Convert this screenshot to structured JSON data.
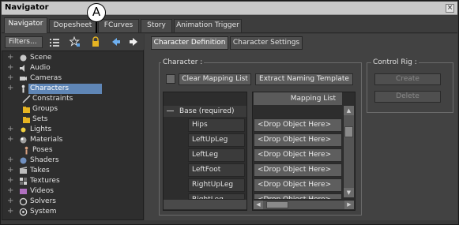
{
  "window": {
    "title": "Navigator",
    "close_glyph": "×"
  },
  "annotation": {
    "letter": "A"
  },
  "main_tabs": [
    {
      "label": "Navigator",
      "active": true
    },
    {
      "label": "Dopesheet",
      "active": false
    },
    {
      "label": "FCurves",
      "active": false
    },
    {
      "label": "Story",
      "active": false
    },
    {
      "label": "Animation Trigger",
      "active": false
    }
  ],
  "toolbar": {
    "filters_label": "Filters...",
    "icons": [
      "list-view-icon",
      "star-filter-icon",
      "lock-icon",
      "arrow-left-icon",
      "arrow-right-icon"
    ]
  },
  "tree": {
    "items": [
      {
        "label": "Scene",
        "icon": "scene-icon",
        "expander": "+"
      },
      {
        "label": "Audio",
        "icon": "audio-icon",
        "expander": "+"
      },
      {
        "label": "Cameras",
        "icon": "camera-icon",
        "expander": "+"
      },
      {
        "label": "Characters",
        "icon": "character-icon",
        "expander": "+",
        "selected": true
      },
      {
        "label": "Constraints",
        "icon": "constraint-icon",
        "expander": ""
      },
      {
        "label": "Groups",
        "icon": "group-icon",
        "expander": ""
      },
      {
        "label": "Sets",
        "icon": "set-icon",
        "expander": ""
      },
      {
        "label": "Lights",
        "icon": "light-icon",
        "expander": "+"
      },
      {
        "label": "Materials",
        "icon": "material-icon",
        "expander": "+"
      },
      {
        "label": "Poses",
        "icon": "pose-icon",
        "expander": ""
      },
      {
        "label": "Shaders",
        "icon": "shader-icon",
        "expander": "+"
      },
      {
        "label": "Takes",
        "icon": "take-icon",
        "expander": "+"
      },
      {
        "label": "Textures",
        "icon": "texture-icon",
        "expander": "+"
      },
      {
        "label": "Videos",
        "icon": "video-icon",
        "expander": "+"
      },
      {
        "label": "Solvers",
        "icon": "solver-icon",
        "expander": "+"
      },
      {
        "label": "System",
        "icon": "system-icon",
        "expander": "+"
      }
    ]
  },
  "sub_tabs": [
    {
      "label": "Character Definition",
      "active": true
    },
    {
      "label": "Character Settings",
      "active": false
    }
  ],
  "character_group": {
    "label": "Character :",
    "clear_button": "Clear Mapping List",
    "extract_button": "Extract Naming Template",
    "mapping_header": "Mapping List",
    "base_label": "Base (required)",
    "rows": [
      {
        "bone": "Hips",
        "slot": "<Drop Object Here>"
      },
      {
        "bone": "LeftUpLeg",
        "slot": "<Drop Object Here>"
      },
      {
        "bone": "LeftLeg",
        "slot": "<Drop Object Here>"
      },
      {
        "bone": "LeftFoot",
        "slot": "<Drop Object Here>"
      },
      {
        "bone": "RightUpLeg",
        "slot": "<Drop Object Here>"
      },
      {
        "bone": "RightLeg",
        "slot": "<Drop Object Here>"
      }
    ]
  },
  "control_rig": {
    "label": "Control Rig :",
    "create_button": "Create",
    "delete_button": "Delete"
  },
  "colors": {
    "selection": "#5f86b6",
    "panel_bg": "#3a3a3a",
    "titlebar_bg": "#c9c9c9"
  }
}
